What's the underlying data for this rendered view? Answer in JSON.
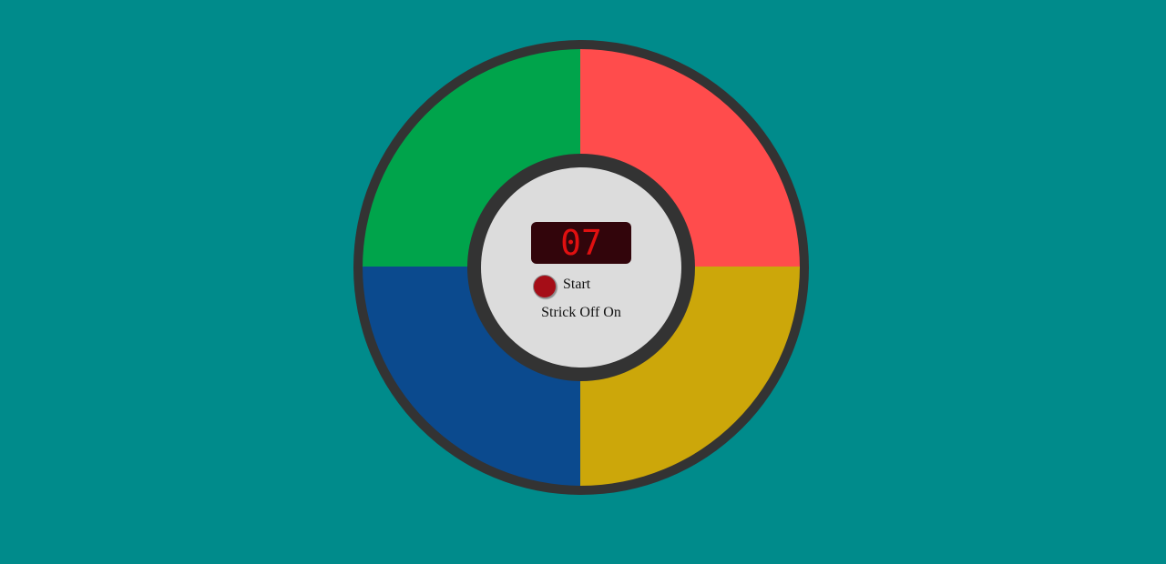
{
  "colors": {
    "background": "#008b8b",
    "board": "#333333",
    "center_face": "#dcdcdc",
    "display_bg": "#32050b",
    "display_text": "#e01010",
    "start_button": "#a50d17"
  },
  "pads": {
    "top_left": {
      "color_name": "green",
      "color": "#00a44b"
    },
    "top_right": {
      "color_name": "red",
      "color": "#ff4c4c"
    },
    "bottom_left": {
      "color_name": "blue",
      "color": "#0b4a8e"
    },
    "bottom_right": {
      "color_name": "yellow",
      "color": "#cca70a"
    }
  },
  "controls": {
    "count_display": "07",
    "start_label": "Start",
    "strict_label": "Strick",
    "strict_off": "Off",
    "strict_on": "On"
  }
}
